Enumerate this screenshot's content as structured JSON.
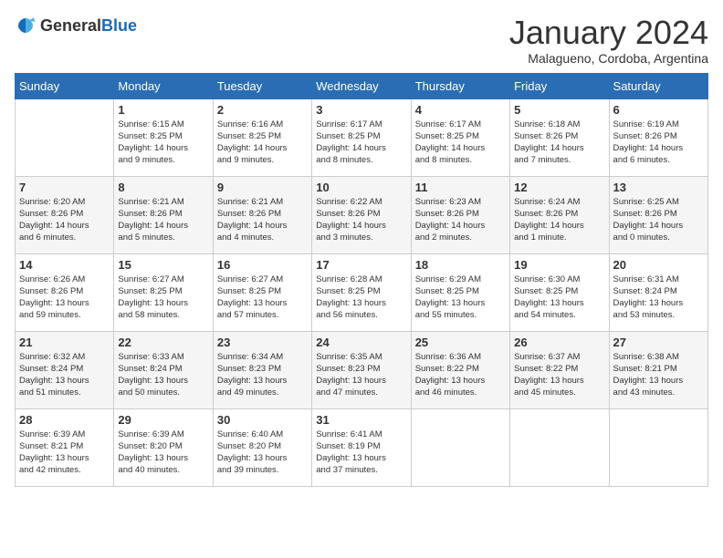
{
  "logo": {
    "general": "General",
    "blue": "Blue"
  },
  "title": "January 2024",
  "location": "Malagueno, Cordoba, Argentina",
  "headers": [
    "Sunday",
    "Monday",
    "Tuesday",
    "Wednesday",
    "Thursday",
    "Friday",
    "Saturday"
  ],
  "weeks": [
    [
      {
        "day": "",
        "content": ""
      },
      {
        "day": "1",
        "content": "Sunrise: 6:15 AM\nSunset: 8:25 PM\nDaylight: 14 hours\nand 9 minutes."
      },
      {
        "day": "2",
        "content": "Sunrise: 6:16 AM\nSunset: 8:25 PM\nDaylight: 14 hours\nand 9 minutes."
      },
      {
        "day": "3",
        "content": "Sunrise: 6:17 AM\nSunset: 8:25 PM\nDaylight: 14 hours\nand 8 minutes."
      },
      {
        "day": "4",
        "content": "Sunrise: 6:17 AM\nSunset: 8:25 PM\nDaylight: 14 hours\nand 8 minutes."
      },
      {
        "day": "5",
        "content": "Sunrise: 6:18 AM\nSunset: 8:26 PM\nDaylight: 14 hours\nand 7 minutes."
      },
      {
        "day": "6",
        "content": "Sunrise: 6:19 AM\nSunset: 8:26 PM\nDaylight: 14 hours\nand 6 minutes."
      }
    ],
    [
      {
        "day": "7",
        "content": "Sunrise: 6:20 AM\nSunset: 8:26 PM\nDaylight: 14 hours\nand 6 minutes."
      },
      {
        "day": "8",
        "content": "Sunrise: 6:21 AM\nSunset: 8:26 PM\nDaylight: 14 hours\nand 5 minutes."
      },
      {
        "day": "9",
        "content": "Sunrise: 6:21 AM\nSunset: 8:26 PM\nDaylight: 14 hours\nand 4 minutes."
      },
      {
        "day": "10",
        "content": "Sunrise: 6:22 AM\nSunset: 8:26 PM\nDaylight: 14 hours\nand 3 minutes."
      },
      {
        "day": "11",
        "content": "Sunrise: 6:23 AM\nSunset: 8:26 PM\nDaylight: 14 hours\nand 2 minutes."
      },
      {
        "day": "12",
        "content": "Sunrise: 6:24 AM\nSunset: 8:26 PM\nDaylight: 14 hours\nand 1 minute."
      },
      {
        "day": "13",
        "content": "Sunrise: 6:25 AM\nSunset: 8:26 PM\nDaylight: 14 hours\nand 0 minutes."
      }
    ],
    [
      {
        "day": "14",
        "content": "Sunrise: 6:26 AM\nSunset: 8:26 PM\nDaylight: 13 hours\nand 59 minutes."
      },
      {
        "day": "15",
        "content": "Sunrise: 6:27 AM\nSunset: 8:25 PM\nDaylight: 13 hours\nand 58 minutes."
      },
      {
        "day": "16",
        "content": "Sunrise: 6:27 AM\nSunset: 8:25 PM\nDaylight: 13 hours\nand 57 minutes."
      },
      {
        "day": "17",
        "content": "Sunrise: 6:28 AM\nSunset: 8:25 PM\nDaylight: 13 hours\nand 56 minutes."
      },
      {
        "day": "18",
        "content": "Sunrise: 6:29 AM\nSunset: 8:25 PM\nDaylight: 13 hours\nand 55 minutes."
      },
      {
        "day": "19",
        "content": "Sunrise: 6:30 AM\nSunset: 8:25 PM\nDaylight: 13 hours\nand 54 minutes."
      },
      {
        "day": "20",
        "content": "Sunrise: 6:31 AM\nSunset: 8:24 PM\nDaylight: 13 hours\nand 53 minutes."
      }
    ],
    [
      {
        "day": "21",
        "content": "Sunrise: 6:32 AM\nSunset: 8:24 PM\nDaylight: 13 hours\nand 51 minutes."
      },
      {
        "day": "22",
        "content": "Sunrise: 6:33 AM\nSunset: 8:24 PM\nDaylight: 13 hours\nand 50 minutes."
      },
      {
        "day": "23",
        "content": "Sunrise: 6:34 AM\nSunset: 8:23 PM\nDaylight: 13 hours\nand 49 minutes."
      },
      {
        "day": "24",
        "content": "Sunrise: 6:35 AM\nSunset: 8:23 PM\nDaylight: 13 hours\nand 47 minutes."
      },
      {
        "day": "25",
        "content": "Sunrise: 6:36 AM\nSunset: 8:22 PM\nDaylight: 13 hours\nand 46 minutes."
      },
      {
        "day": "26",
        "content": "Sunrise: 6:37 AM\nSunset: 8:22 PM\nDaylight: 13 hours\nand 45 minutes."
      },
      {
        "day": "27",
        "content": "Sunrise: 6:38 AM\nSunset: 8:21 PM\nDaylight: 13 hours\nand 43 minutes."
      }
    ],
    [
      {
        "day": "28",
        "content": "Sunrise: 6:39 AM\nSunset: 8:21 PM\nDaylight: 13 hours\nand 42 minutes."
      },
      {
        "day": "29",
        "content": "Sunrise: 6:39 AM\nSunset: 8:20 PM\nDaylight: 13 hours\nand 40 minutes."
      },
      {
        "day": "30",
        "content": "Sunrise: 6:40 AM\nSunset: 8:20 PM\nDaylight: 13 hours\nand 39 minutes."
      },
      {
        "day": "31",
        "content": "Sunrise: 6:41 AM\nSunset: 8:19 PM\nDaylight: 13 hours\nand 37 minutes."
      },
      {
        "day": "",
        "content": ""
      },
      {
        "day": "",
        "content": ""
      },
      {
        "day": "",
        "content": ""
      }
    ]
  ]
}
